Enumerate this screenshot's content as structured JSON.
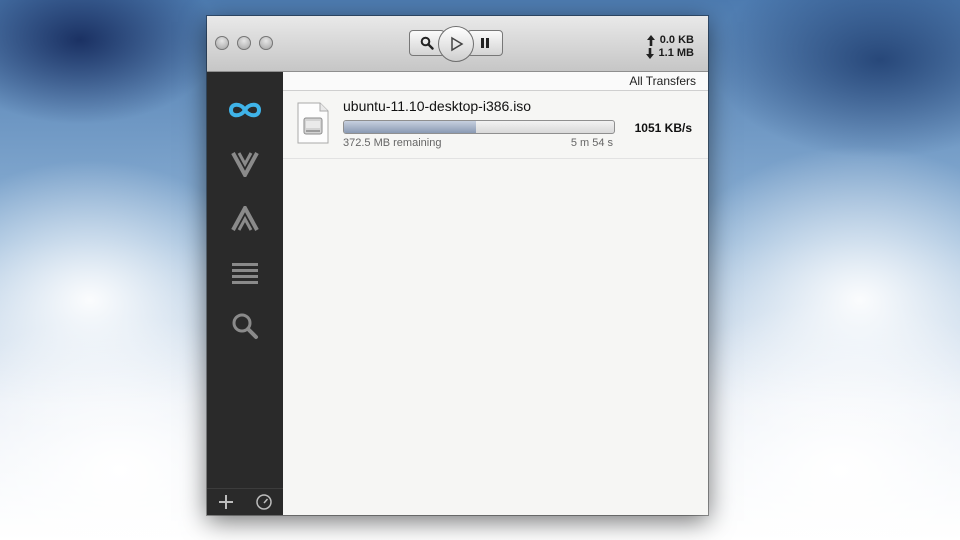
{
  "toolbar": {
    "upload_rate": "0.0 KB",
    "download_rate": "1.1 MB"
  },
  "main": {
    "filter_label": "All Transfers",
    "transfers": [
      {
        "filename": "ubuntu-11.10-desktop-i386.iso",
        "remaining": "372.5 MB remaining",
        "eta": "5 m 54 s",
        "speed": "1051 KB/s",
        "progress": 0.49
      }
    ]
  },
  "sidebar": {
    "items": [
      "infinity-icon",
      "download-v-icon",
      "upload-a-icon",
      "list-icon",
      "search-icon"
    ],
    "bottom": [
      "add-icon",
      "speedometer-icon"
    ]
  },
  "colors": {
    "sidebar_bg": "#2a2a2a",
    "accent_blue": "#3fb3e8",
    "progress_fill": "#8a9ab3"
  }
}
